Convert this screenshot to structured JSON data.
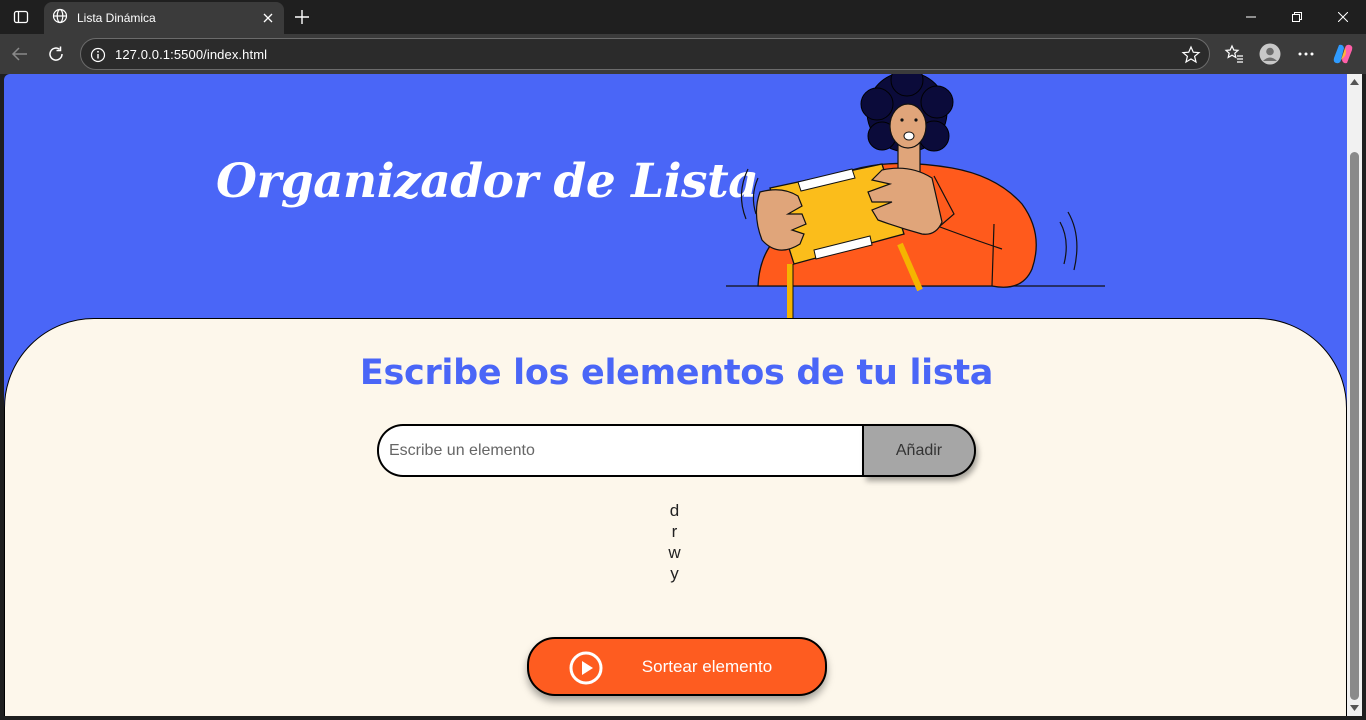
{
  "browser": {
    "tab_title": "Lista Dinámica",
    "url": "127.0.0.1:5500/index.html"
  },
  "page": {
    "header_title": "Organizador de Lista",
    "heading": "Escribe los elementos de tu lista",
    "input_placeholder": "Escribe un elemento",
    "input_value": "",
    "add_button_label": "Añadir",
    "items": [
      "d",
      "r",
      "w",
      "y"
    ],
    "draw_button_label": "Sortear elemento"
  },
  "colors": {
    "header_bg": "#4a66f7",
    "card_bg": "#fdf7eb",
    "accent_orange": "#fe5c20",
    "add_button_bg": "#a6a6a6"
  }
}
